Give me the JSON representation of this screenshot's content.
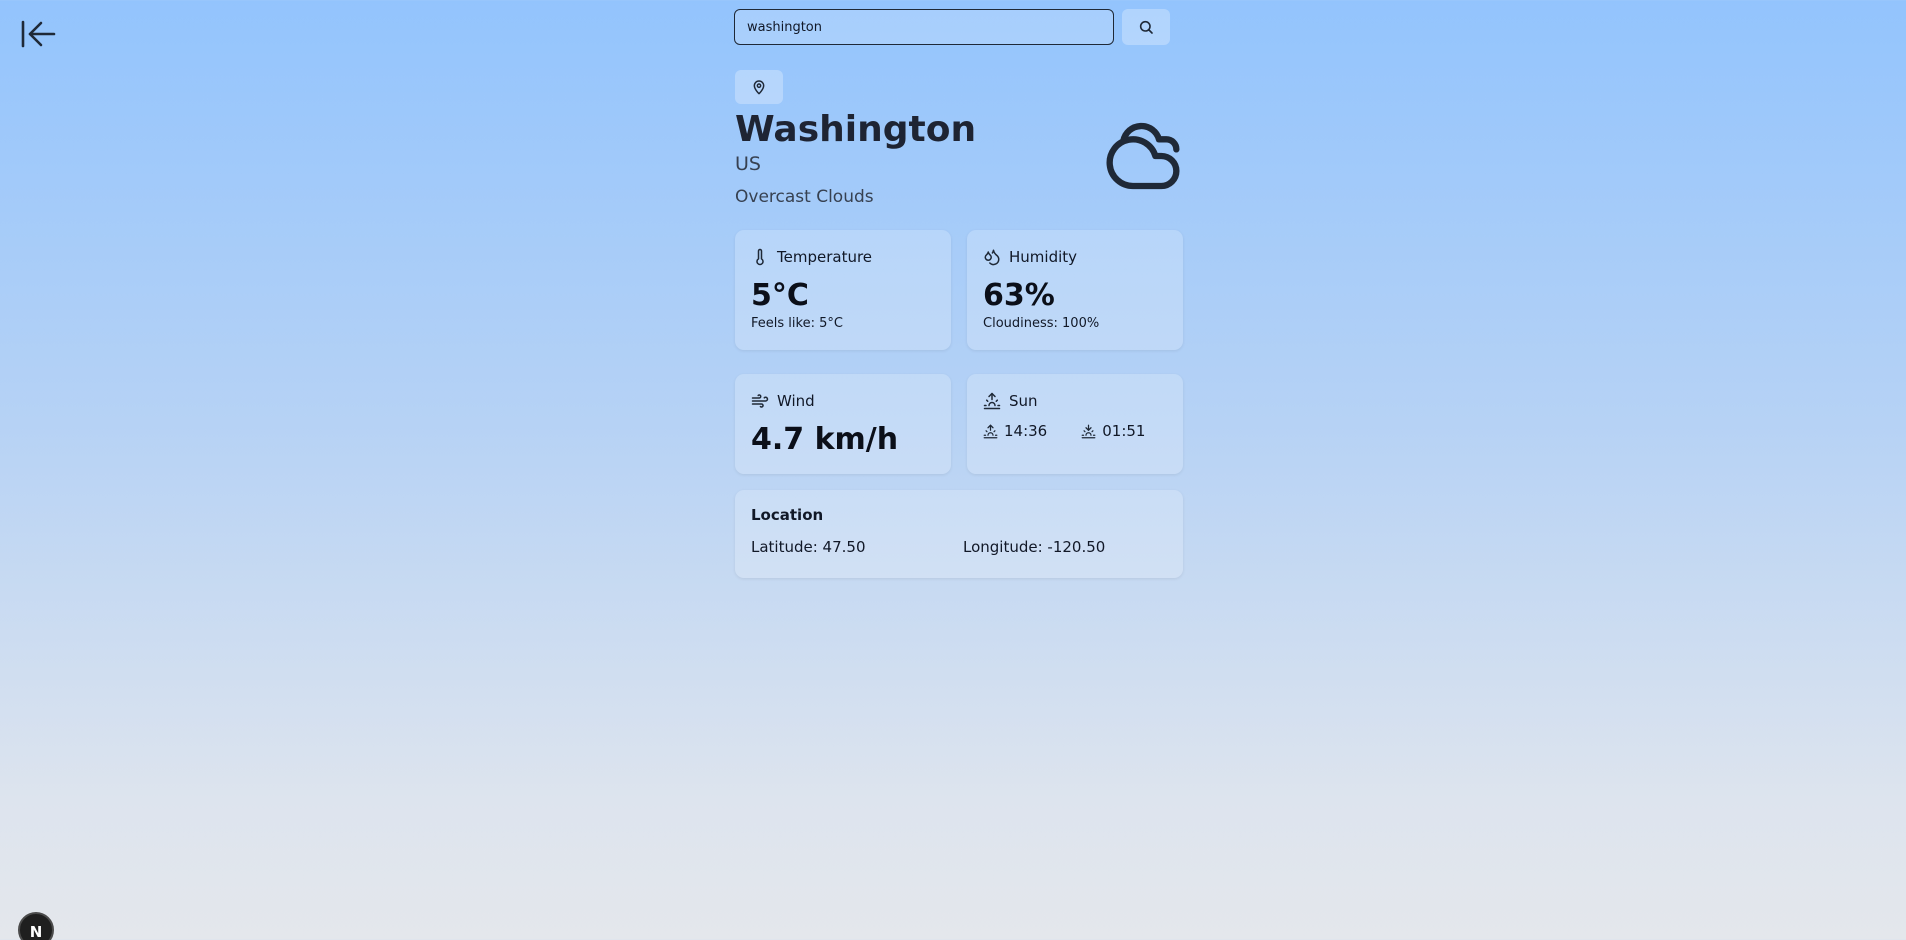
{
  "search": {
    "value": "washington",
    "button_icon": "search-icon"
  },
  "nav": {
    "back_icon": "arrow-left-to-line-icon"
  },
  "weather": {
    "location_icon": "map-pin-icon",
    "city": "Washington",
    "country": "US",
    "description": "Overcast Clouds",
    "condition_icon": "cloud-icon"
  },
  "cards": {
    "temperature": {
      "title": "Temperature",
      "icon": "thermometer-icon",
      "value": "5°C",
      "sub": "Feels like: 5°C"
    },
    "humidity": {
      "title": "Humidity",
      "icon": "droplets-icon",
      "value": "63%",
      "sub": "Cloudiness: 100%"
    },
    "wind": {
      "title": "Wind",
      "icon": "wind-icon",
      "value": "4.7 km/h"
    },
    "sun": {
      "title": "Sun",
      "icon": "sunrise-icon",
      "sunrise": "14:36",
      "sunset": "01:51"
    }
  },
  "location": {
    "title": "Location",
    "latitude": "Latitude: 47.50",
    "longitude": "Longitude: -120.50"
  },
  "badge": {
    "label": "N"
  }
}
